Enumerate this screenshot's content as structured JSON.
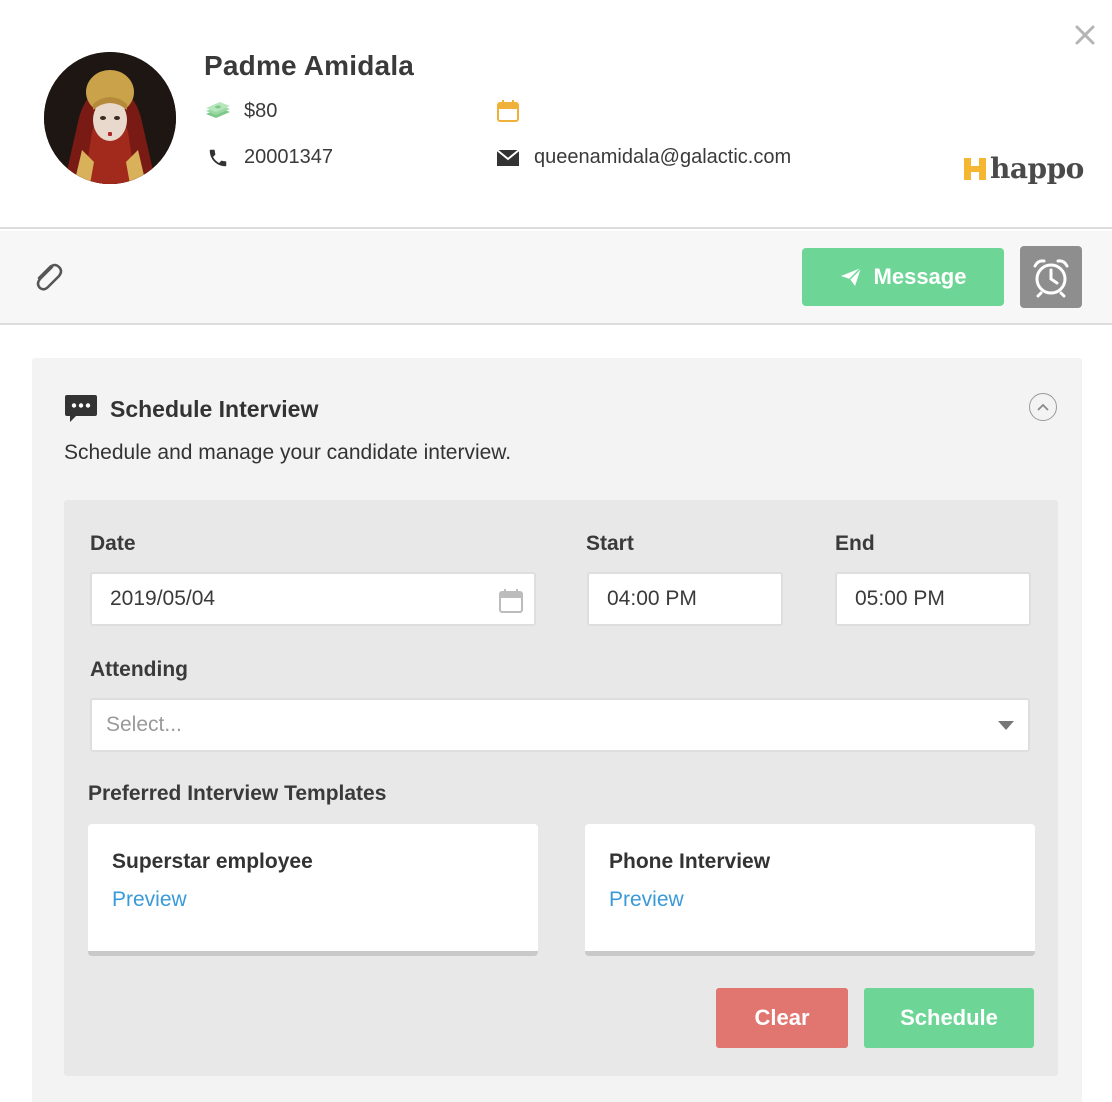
{
  "profile": {
    "name": "Padme Amidala",
    "salary": "$80",
    "phone": "20001347",
    "date": "",
    "email": "queenamidala@galactic.com"
  },
  "brand": {
    "logo_text": "happo",
    "logo_color": "#f5b731"
  },
  "toolbar": {
    "message_label": "Message"
  },
  "colors": {
    "green": "#6dd696",
    "red": "#e17570",
    "link": "#3a9ad9",
    "gray_button": "#8e8e8e"
  },
  "schedule": {
    "title": "Schedule Interview",
    "description": "Schedule and manage your candidate interview.",
    "date_label": "Date",
    "date_value": "2019/05/04",
    "start_label": "Start",
    "start_value": "04:00 PM",
    "end_label": "End",
    "end_value": "05:00 PM",
    "attending_label": "Attending",
    "attending_placeholder": "Select...",
    "templates_label": "Preferred Interview Templates",
    "templates": [
      {
        "title": "Superstar employee",
        "preview": "Preview"
      },
      {
        "title": "Phone Interview",
        "preview": "Preview"
      }
    ],
    "clear_label": "Clear",
    "schedule_label": "Schedule"
  }
}
